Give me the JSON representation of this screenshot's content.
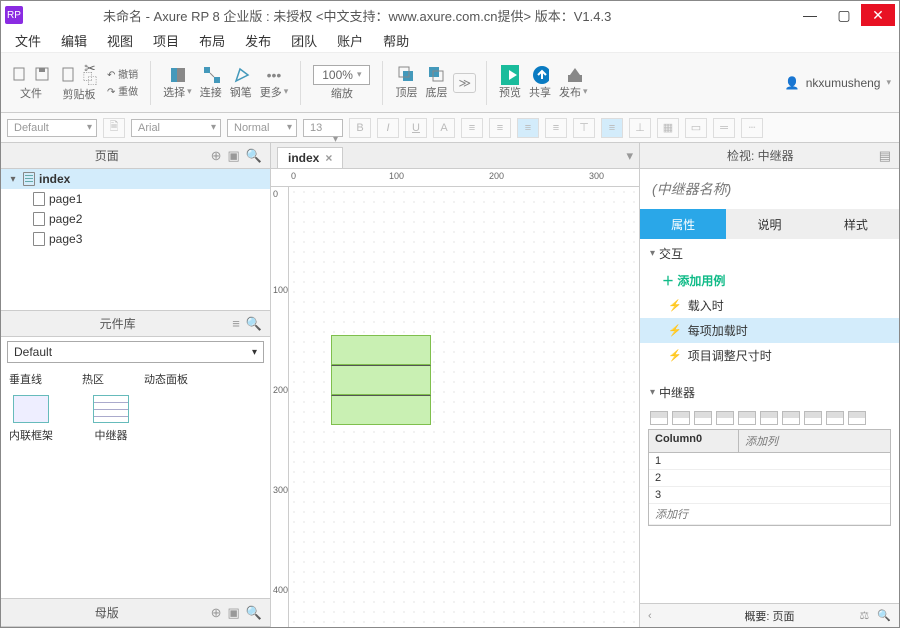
{
  "titlebar": {
    "logo": "RP",
    "title": "未命名 - Axure RP 8 企业版 : 未授权    <中文支持：www.axure.com.cn提供>  版本：V1.4.3"
  },
  "menu": [
    "文件",
    "编辑",
    "视图",
    "项目",
    "布局",
    "发布",
    "团队",
    "账户",
    "帮助"
  ],
  "toolbar": {
    "groups": {
      "file": "文件",
      "clipboard": "剪贴板",
      "undo_label": "撤销",
      "redo_label": "重做",
      "select": "选择",
      "connect": "连接",
      "pen": "钢笔",
      "more": "更多",
      "zoom": "缩放",
      "zoom_value": "100%",
      "front": "顶层",
      "back": "底层",
      "preview": "预览",
      "share": "共享",
      "publish": "发布"
    },
    "user": "nkxumusheng"
  },
  "formatbar": {
    "style": "Default",
    "font": "Arial",
    "weight": "Normal",
    "size": "13"
  },
  "left": {
    "pages_title": "页面",
    "pages": {
      "root": "index",
      "children": [
        "page1",
        "page2",
        "page3"
      ]
    },
    "lib_title": "元件库",
    "lib_select": "Default",
    "lib_row1": [
      "垂直线",
      "热区",
      "动态面板"
    ],
    "lib_row2": [
      "内联框架",
      "中继器"
    ],
    "masters_title": "母版"
  },
  "center": {
    "tab": "index",
    "ruler_h": [
      "0",
      "100",
      "200",
      "300"
    ],
    "ruler_v": [
      "0",
      "100",
      "200",
      "300",
      "400"
    ]
  },
  "right": {
    "panel_title": "检视: 中继器",
    "name_placeholder": "(中继器名称)",
    "tabs": [
      "属性",
      "说明",
      "样式"
    ],
    "section_interactions": "交互",
    "add_case": "添加用例",
    "events": [
      "载入时",
      "每项加载时",
      "项目调整尺寸时"
    ],
    "section_repeater": "中继器",
    "table": {
      "col0": "Column0",
      "add_col": "添加列",
      "rows": [
        "1",
        "2",
        "3"
      ],
      "add_row": "添加行"
    },
    "footer": "概要: 页面"
  }
}
